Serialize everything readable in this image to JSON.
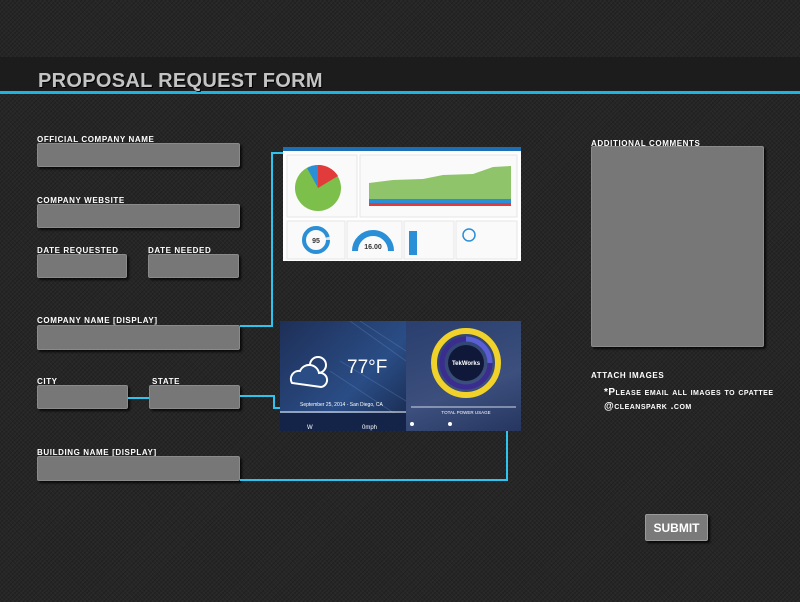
{
  "header": {
    "title": "PROPOSAL REQUEST FORM"
  },
  "form": {
    "official_company_name": {
      "label": "Official Company Name",
      "value": ""
    },
    "company_website": {
      "label": "Company Website",
      "value": ""
    },
    "date_requested": {
      "label": "Date Requested",
      "value": ""
    },
    "date_needed": {
      "label": "Date Needed",
      "value": ""
    },
    "company_name_display": {
      "label": "Company Name [display]",
      "value": ""
    },
    "city": {
      "label": "City",
      "value": ""
    },
    "state": {
      "label": "State",
      "value": ""
    },
    "building_name_display": {
      "label": "Building Name [display]",
      "value": ""
    },
    "additional_comments": {
      "label": "Additional Comments",
      "value": ""
    },
    "attach_images": {
      "label": "Attach Images",
      "note": "*Please email all images to cpattee @cleanspark .com"
    },
    "submit_label": "SUBMIT"
  },
  "preview_dashboard": {
    "gauge_value": "95",
    "dial_value": "16.00",
    "weather_temp": "77°F",
    "weather_date": "September 25, 2014 - San Diego, CA",
    "weather_left": "W",
    "weather_right": "0mph",
    "brand": "TekWorks",
    "power_label": "TOTAL POWER USAGE"
  },
  "colors": {
    "accent": "#2ec4ee",
    "field": "#777777",
    "background": "#262626"
  }
}
